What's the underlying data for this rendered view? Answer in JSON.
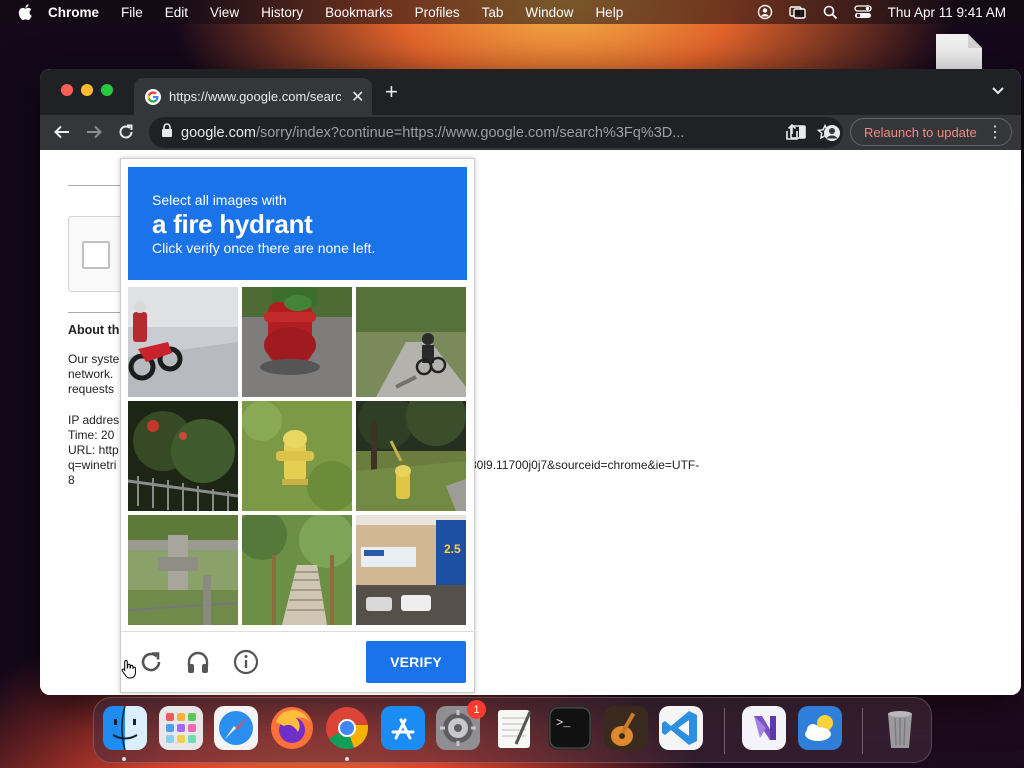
{
  "menubar": {
    "app": "Chrome",
    "items": [
      "File",
      "Edit",
      "View",
      "History",
      "Bookmarks",
      "Profiles",
      "Tab",
      "Window",
      "Help"
    ],
    "clock": "Thu Apr 11  9:41 AM"
  },
  "browser": {
    "tab_title": "https://www.google.com/search?",
    "url_host": "google.com",
    "url_path": "/sorry/index?continue=https://www.google.com/search%3Fq%3D...",
    "relaunch_label": "Relaunch to update"
  },
  "page": {
    "about_heading": "About th",
    "paragraph": "Our syste\nnetwork.\nrequests",
    "details": "IP addres\nTime: 20\nURL: http\nq=winetri\n8",
    "url_tail": "30l9.11700j0j7&sourceid=chrome&ie=UTF-"
  },
  "captcha": {
    "instruction": "Select all images with",
    "target": "a fire hydrant",
    "subtext": "Click verify once there are none left.",
    "verify_label": "VERIFY",
    "tiles": [
      "motorcycle rider on road",
      "red fire hydrant",
      "cyclist on path",
      "shrubs and fence",
      "yellow fire hydrant in grass",
      "yellow fire hydrant under tree",
      "concrete bridge pillar",
      "stairs with trees",
      "storefront building"
    ]
  },
  "dock": {
    "badge_count": "1",
    "apps": [
      "finder",
      "launchpad",
      "safari",
      "firefox",
      "chrome",
      "app-store",
      "system-settings",
      "textedit",
      "terminal",
      "garageband",
      "vscode",
      "visual-studio",
      "weather",
      "trash"
    ]
  }
}
